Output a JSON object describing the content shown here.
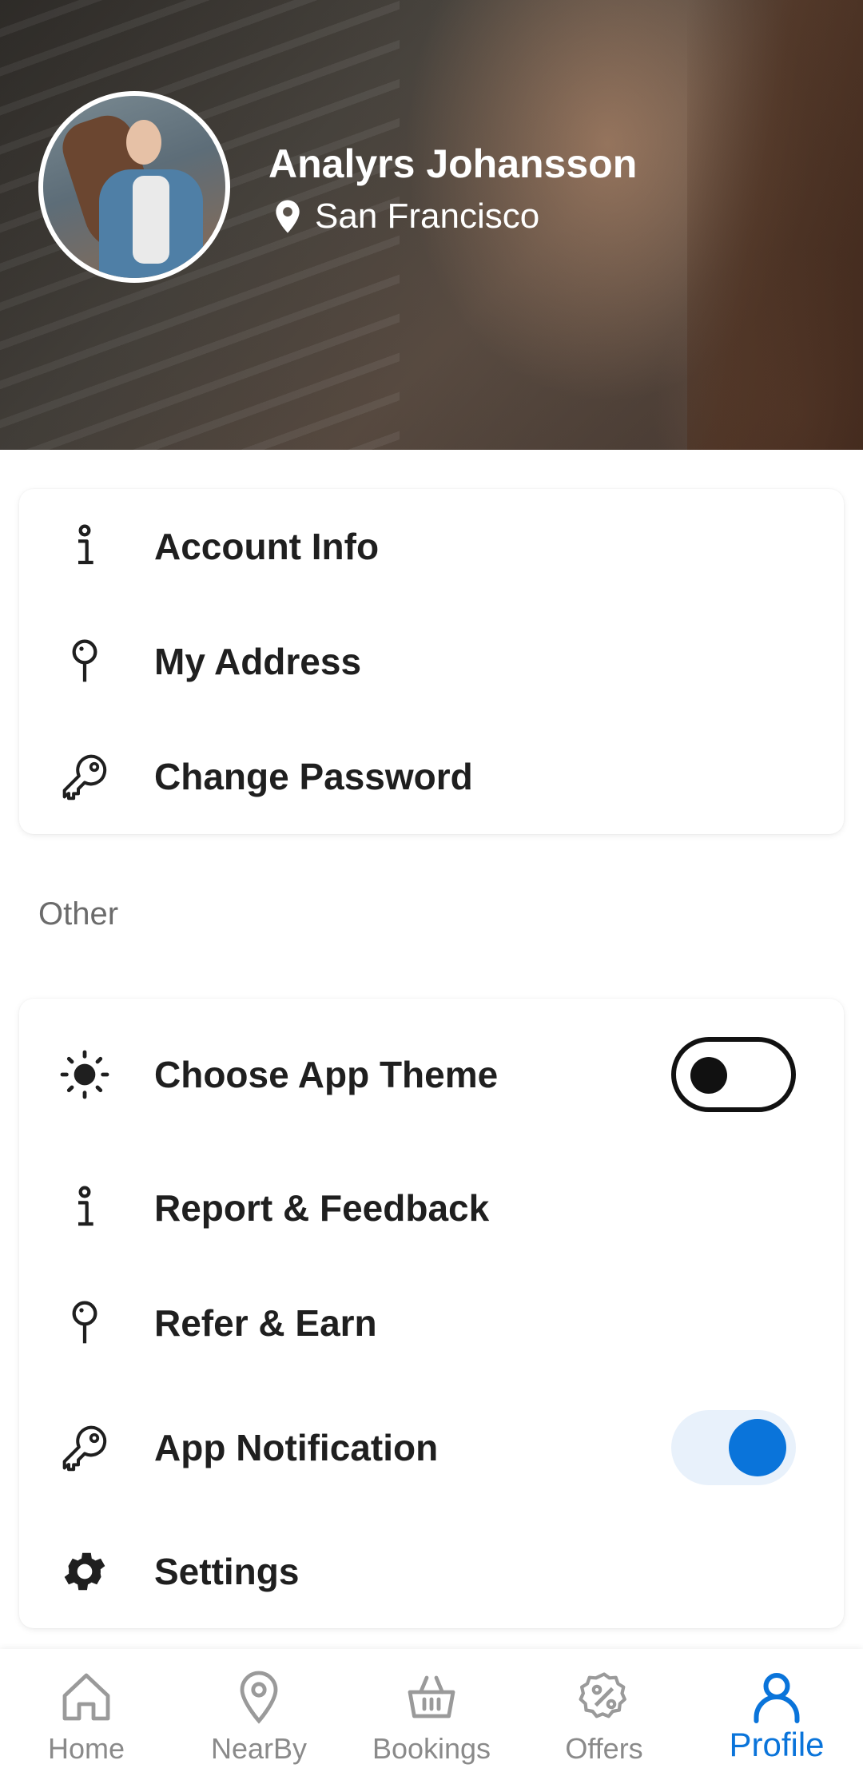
{
  "header": {
    "name": "Analyrs Johansson",
    "location": "San Francisco"
  },
  "account_menu": [
    {
      "label": "Account Info",
      "icon": "info-icon"
    },
    {
      "label": "My Address",
      "icon": "pin-icon"
    },
    {
      "label": "Change Password",
      "icon": "key-icon"
    }
  ],
  "section_other_label": "Other",
  "other_menu": [
    {
      "label": "Choose App Theme",
      "icon": "sun-icon",
      "toggle": "off"
    },
    {
      "label": "Report & Feedback",
      "icon": "info-icon"
    },
    {
      "label": "Refer & Earn",
      "icon": "pin-icon"
    },
    {
      "label": "App Notification",
      "icon": "key-icon",
      "toggle": "on"
    },
    {
      "label": "Settings",
      "icon": "gear-icon"
    }
  ],
  "bottom_nav": [
    {
      "label": "Home",
      "icon": "home-icon",
      "active": false
    },
    {
      "label": "NearBy",
      "icon": "location-icon",
      "active": false
    },
    {
      "label": "Bookings",
      "icon": "basket-icon",
      "active": false
    },
    {
      "label": "Offers",
      "icon": "discount-icon",
      "active": false
    },
    {
      "label": "Profile",
      "icon": "user-icon",
      "active": true
    }
  ],
  "colors": {
    "accent": "#0a74da",
    "inactive_nav": "#8a8a8a",
    "text_primary": "#1f1f1f",
    "section_label": "#6b6b6b"
  }
}
